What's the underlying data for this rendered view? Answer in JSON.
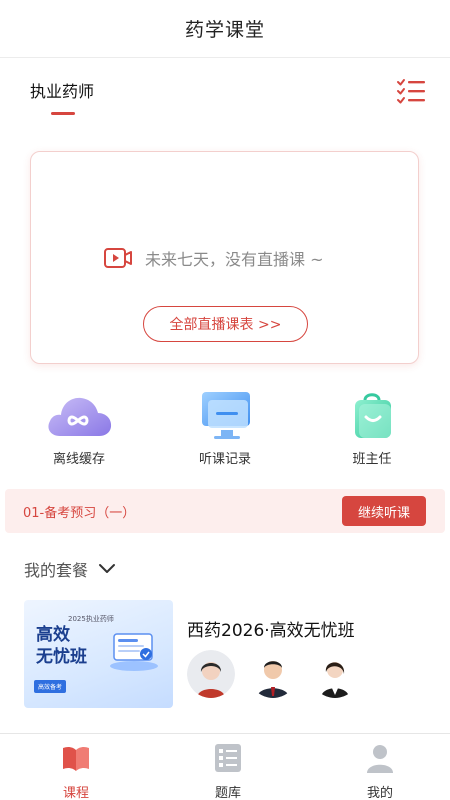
{
  "header": {
    "title": "药学课堂"
  },
  "subnav": {
    "active_tab": "执业药师",
    "menu_icon": "list-check-icon"
  },
  "live": {
    "empty_text": "未来七天，没有直播课 ~",
    "schedule_button": "全部直播课表 >>",
    "icon": "video-camera-icon"
  },
  "shortcuts": [
    {
      "label": "离线缓存",
      "icon": "cloud-icon"
    },
    {
      "label": "听课记录",
      "icon": "monitor-icon"
    },
    {
      "label": "班主任",
      "icon": "bag-smile-icon"
    }
  ],
  "continue": {
    "lesson": "01-备考预习（一）",
    "button": "继续听课"
  },
  "packages": {
    "header": "我的套餐",
    "items": [
      {
        "name": "西药2026·高效无忧班",
        "cover_title_line1": "高效",
        "cover_title_line2": "无忧班",
        "cover_subtitle": "2025执业药师",
        "cover_tag": "高效备考"
      }
    ]
  },
  "tabbar": {
    "items": [
      {
        "label": "课程",
        "icon": "book-icon",
        "active": true
      },
      {
        "label": "题库",
        "icon": "question-bank-icon",
        "active": false
      },
      {
        "label": "我的",
        "icon": "user-icon",
        "active": false
      }
    ]
  },
  "colors": {
    "accent": "#d6463f",
    "accent_light": "#fdeeed"
  }
}
